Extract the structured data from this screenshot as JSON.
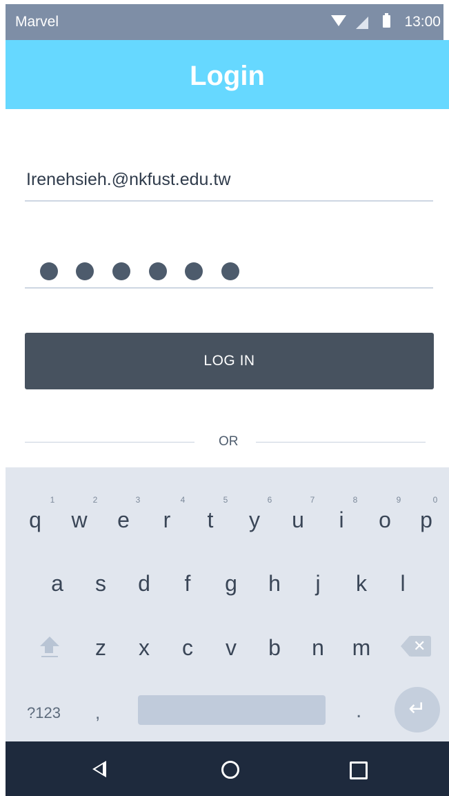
{
  "status_bar": {
    "carrier": "Marvel",
    "time": "13:00",
    "icons": [
      "wifi-icon",
      "signal-icon",
      "battery-icon"
    ]
  },
  "app_bar": {
    "title": "Login",
    "color": "#66d8ff"
  },
  "form": {
    "email_value": "Irenehsieh.@nkfust.edu.tw",
    "password_mask": "●●●●●●",
    "login_label": "LOG IN",
    "divider_label": "OR"
  },
  "keyboard": {
    "row1": [
      "q",
      "w",
      "e",
      "r",
      "t",
      "y",
      "u",
      "i",
      "o",
      "p"
    ],
    "row1_hints": [
      "1",
      "2",
      "3",
      "4",
      "5",
      "6",
      "7",
      "8",
      "9",
      "0"
    ],
    "row2": [
      "a",
      "s",
      "d",
      "f",
      "g",
      "h",
      "j",
      "k",
      "l"
    ],
    "row3": [
      "z",
      "x",
      "c",
      "v",
      "b",
      "n",
      "m"
    ],
    "symbols_label": "?123",
    "comma": ",",
    "period": ".",
    "enter_glyph": "↵",
    "backspace_glyph": "✕"
  },
  "nav_bar": {
    "icons": [
      "back-icon",
      "home-icon",
      "recents-icon"
    ]
  }
}
